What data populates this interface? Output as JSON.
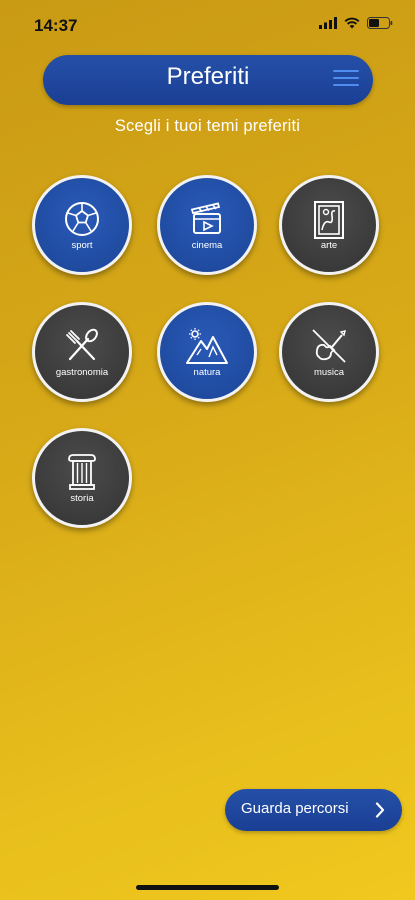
{
  "status_bar": {
    "time": "14:37"
  },
  "header": {
    "title": "Preferiti"
  },
  "subtitle": "Scegli i tuoi temi preferiti",
  "themes": [
    {
      "label": "sport",
      "selected": true
    },
    {
      "label": "cinema",
      "selected": true
    },
    {
      "label": "arte",
      "selected": false
    },
    {
      "label": "gastronomia",
      "selected": false
    },
    {
      "label": "natura",
      "selected": true
    },
    {
      "label": "musica",
      "selected": false
    },
    {
      "label": "storia",
      "selected": false
    }
  ],
  "cta": {
    "label": "Guarda percorsi"
  },
  "colors": {
    "selected": "#1b4596",
    "unselected": "#333333",
    "background": "#d8aa18"
  }
}
